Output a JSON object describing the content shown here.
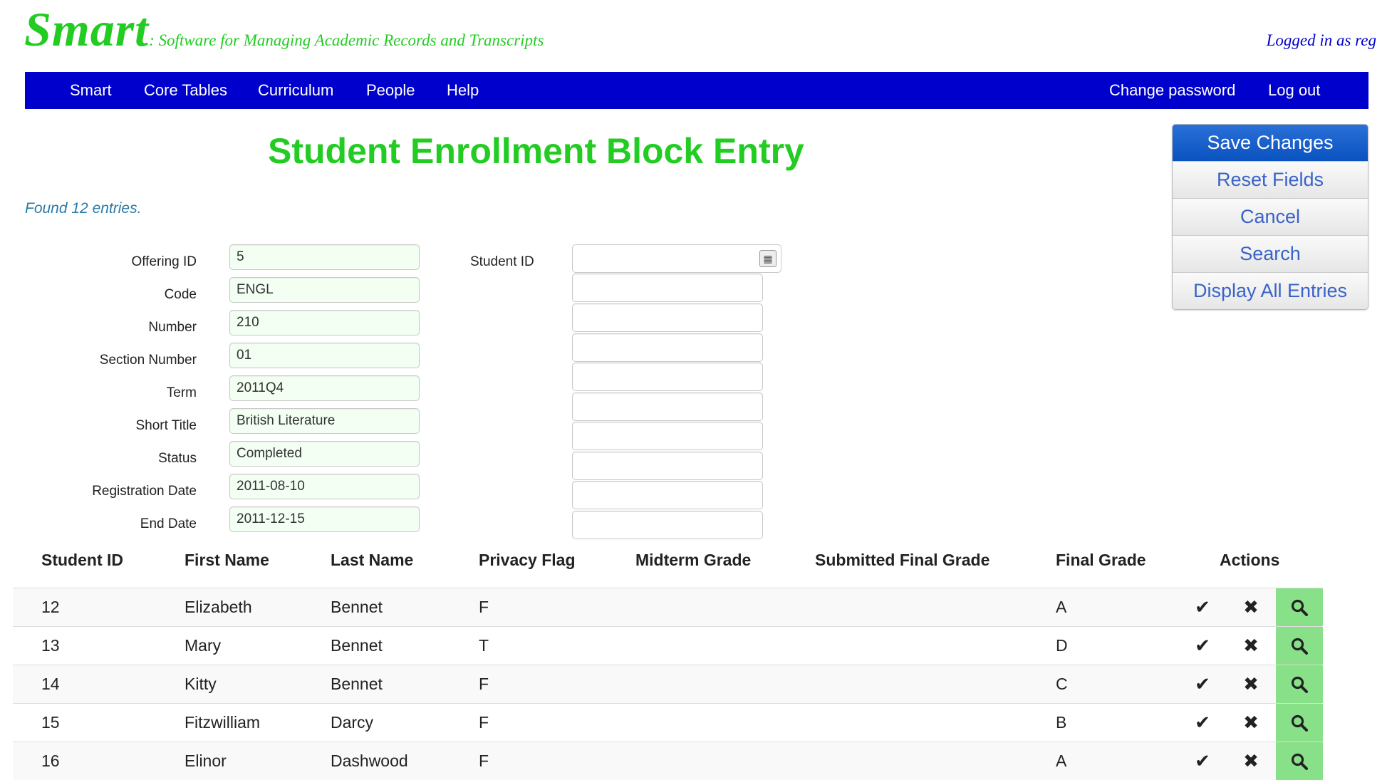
{
  "header": {
    "logo": "Smart",
    "tagline": ": Software for Managing Academic Records and Transcripts",
    "logged_in": "Logged in as reg"
  },
  "nav": {
    "left": [
      "Smart",
      "Core Tables",
      "Curriculum",
      "People",
      "Help"
    ],
    "right": [
      "Change password",
      "Log out"
    ]
  },
  "page": {
    "title": "Student Enrollment Block Entry",
    "found": "Found 12 entries."
  },
  "actions": [
    "Save Changes",
    "Reset Fields",
    "Cancel",
    "Search",
    "Display All Entries"
  ],
  "form": {
    "fields": [
      {
        "label": "Offering ID",
        "value": "5"
      },
      {
        "label": "Code",
        "value": "ENGL"
      },
      {
        "label": "Number",
        "value": "210"
      },
      {
        "label": "Section Number",
        "value": "01"
      },
      {
        "label": "Term",
        "value": "2011Q4"
      },
      {
        "label": "Short Title",
        "value": "British Literature"
      },
      {
        "label": "Status",
        "value": "Completed"
      },
      {
        "label": "Registration Date",
        "value": "2011-08-10"
      },
      {
        "label": "End Date",
        "value": "2011-12-15"
      }
    ],
    "student_id_label": "Student ID",
    "student_id_count": 10
  },
  "table": {
    "columns": [
      "Student ID",
      "First Name",
      "Last Name",
      "Privacy Flag",
      "Midterm Grade",
      "Submitted Final Grade",
      "Final Grade",
      "Actions"
    ],
    "rows": [
      {
        "id": "12",
        "first": "Elizabeth",
        "last": "Bennet",
        "privacy": "F",
        "midterm": "",
        "submitted": "",
        "final": "A"
      },
      {
        "id": "13",
        "first": "Mary",
        "last": "Bennet",
        "privacy": "T",
        "midterm": "",
        "submitted": "",
        "final": "D"
      },
      {
        "id": "14",
        "first": "Kitty",
        "last": "Bennet",
        "privacy": "F",
        "midterm": "",
        "submitted": "",
        "final": "C"
      },
      {
        "id": "15",
        "first": "Fitzwilliam",
        "last": "Darcy",
        "privacy": "F",
        "midterm": "",
        "submitted": "",
        "final": "B"
      },
      {
        "id": "16",
        "first": "Elinor",
        "last": "Dashwood",
        "privacy": "F",
        "midterm": "",
        "submitted": "",
        "final": "A"
      }
    ],
    "row_icons": {
      "accept": "check-icon",
      "reject": "x-icon",
      "search": "magnifier-icon"
    }
  },
  "colors": {
    "brand_green": "#22cc22",
    "nav_blue": "#0000cc",
    "primary_button": "#0a52bf",
    "search_button": "#88e088"
  }
}
